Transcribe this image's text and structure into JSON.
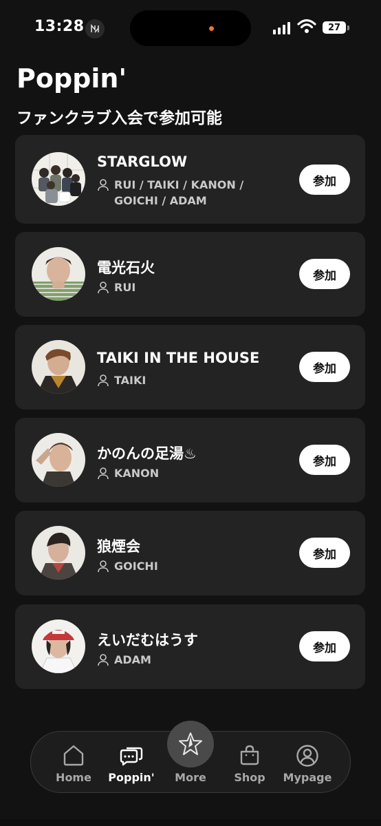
{
  "status_bar": {
    "time": "13:28",
    "battery": "27"
  },
  "page": {
    "title": "Poppin'",
    "subtitle": "ファンクラブ入会で参加可能"
  },
  "clubs": [
    {
      "name": "STARGLOW",
      "members": "RUI / TAIKI / KANON / GOICHI / ADAM",
      "join_label": "参加"
    },
    {
      "name": "電光石火",
      "members": "RUI",
      "join_label": "参加"
    },
    {
      "name": "TAIKI IN THE HOUSE",
      "members": "TAIKI",
      "join_label": "参加"
    },
    {
      "name": "かのんの足湯♨",
      "members": "KANON",
      "join_label": "参加"
    },
    {
      "name": "狼煙会",
      "members": "GOICHI",
      "join_label": "参加"
    },
    {
      "name": "えいだむはうす",
      "members": "ADAM",
      "join_label": "参加"
    }
  ],
  "nav": {
    "home": "Home",
    "poppin": "Poppin'",
    "more": "More",
    "shop": "Shop",
    "mypage": "Mypage"
  }
}
